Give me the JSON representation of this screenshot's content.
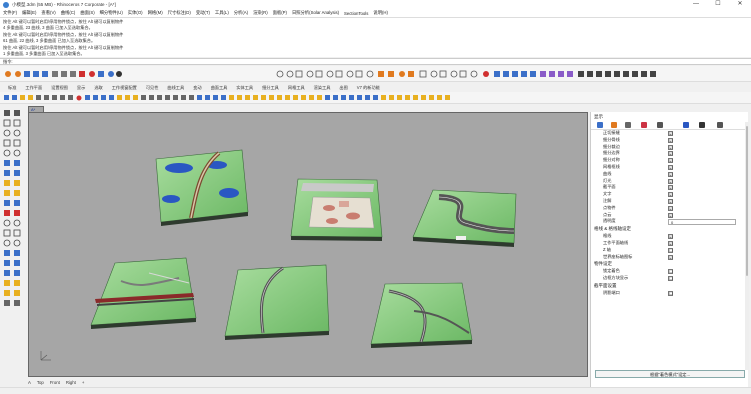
{
  "window": {
    "title": "小模型.3dm (55 MB) - Rhinoceros 7 Corporate - [A*]",
    "minimize": "—",
    "maximize": "☐",
    "close": "✕"
  },
  "menu": [
    "文件(F)",
    "编辑(E)",
    "查看(V)",
    "曲线(C)",
    "曲面(S)",
    "细分物件(U)",
    "实体(O)",
    "网格(M)",
    "尺寸标注(D)",
    "变动(T)",
    "工具(L)",
    "分析(A)",
    "渲染(R)",
    "面板(P)",
    "日照分析(Solar Analysis)",
    "SectionTools",
    "说明(H)"
  ],
  "command_history": [
    "按住 Alt 键可以暂时启用/停用物件锁点，按住 Alt 键可以复制物件",
    "4 多重曲面, 23 曲线, 3 曲面 已加入至选取集合。",
    "按住 Alt 键可以暂时启用/停用物件锁点，按住 Alt 键可以复制物件",
    "61 曲面, 22 曲线, 3 多重曲面 已加入至选取集合。",
    "按住 Alt 键可以暂时启用/停用物件锁点，按住 Alt 键可以复制物件",
    "1 多重曲面, 3 多重曲面 已加入至选取集合。"
  ],
  "command_prompt": "指令:",
  "tabs": [
    "标准",
    "工作平面",
    "设置视图",
    "显示",
    "选取",
    "工作视窗配置",
    "可见性",
    "曲线工具",
    "变动",
    "曲面工具",
    "实体工具",
    "细分工具",
    "网格工具",
    "渲染工具",
    "出图",
    "V7 的新功能"
  ],
  "viewport": {
    "active_label": "A*",
    "bottom_tabs": [
      "A",
      "Top",
      "Front",
      "Right",
      "+"
    ],
    "bg_color": "#a6a6a6",
    "model_color": "#7fc77a"
  },
  "panel": {
    "title": "显示",
    "rows": [
      {
        "label": "正切接缝",
        "checked": "☑"
      },
      {
        "label": "细分骨线",
        "checked": "☑"
      },
      {
        "label": "细分裁边",
        "checked": "☑"
      },
      {
        "label": "细分边界",
        "checked": "☑"
      },
      {
        "label": "细分对称",
        "checked": "☑"
      },
      {
        "label": "网格框线",
        "checked": "☑"
      },
      {
        "label": "曲线",
        "checked": "☑"
      },
      {
        "label": "灯光",
        "checked": "☑"
      },
      {
        "label": "截平面",
        "checked": "☑"
      },
      {
        "label": "文字",
        "checked": "☑"
      },
      {
        "label": "注解",
        "checked": "☑"
      },
      {
        "label": "点物件",
        "checked": "☑"
      },
      {
        "label": "点云",
        "checked": "☑"
      }
    ],
    "transparency_label": "透明度",
    "transparency_value": "0",
    "section1": "格线 & 格线轴设定",
    "section1_rows": [
      {
        "label": "格线",
        "checked": "☑"
      },
      {
        "label": "工作平面轴线",
        "checked": "☑"
      },
      {
        "label": "Z 轴",
        "checked": "☐"
      },
      {
        "label": "世界座标轴图标",
        "checked": "☑"
      }
    ],
    "section2": "物件设定",
    "section2_rows": [
      {
        "label": "锁定着色",
        "checked": "☐"
      },
      {
        "label": "边框方块显示",
        "checked": "☐"
      }
    ],
    "section3": "截平面设置",
    "section3_rows": [
      {
        "label": "阴影端口",
        "checked": "☐"
      }
    ],
    "button": "根据\"着色模式\"设定..."
  }
}
